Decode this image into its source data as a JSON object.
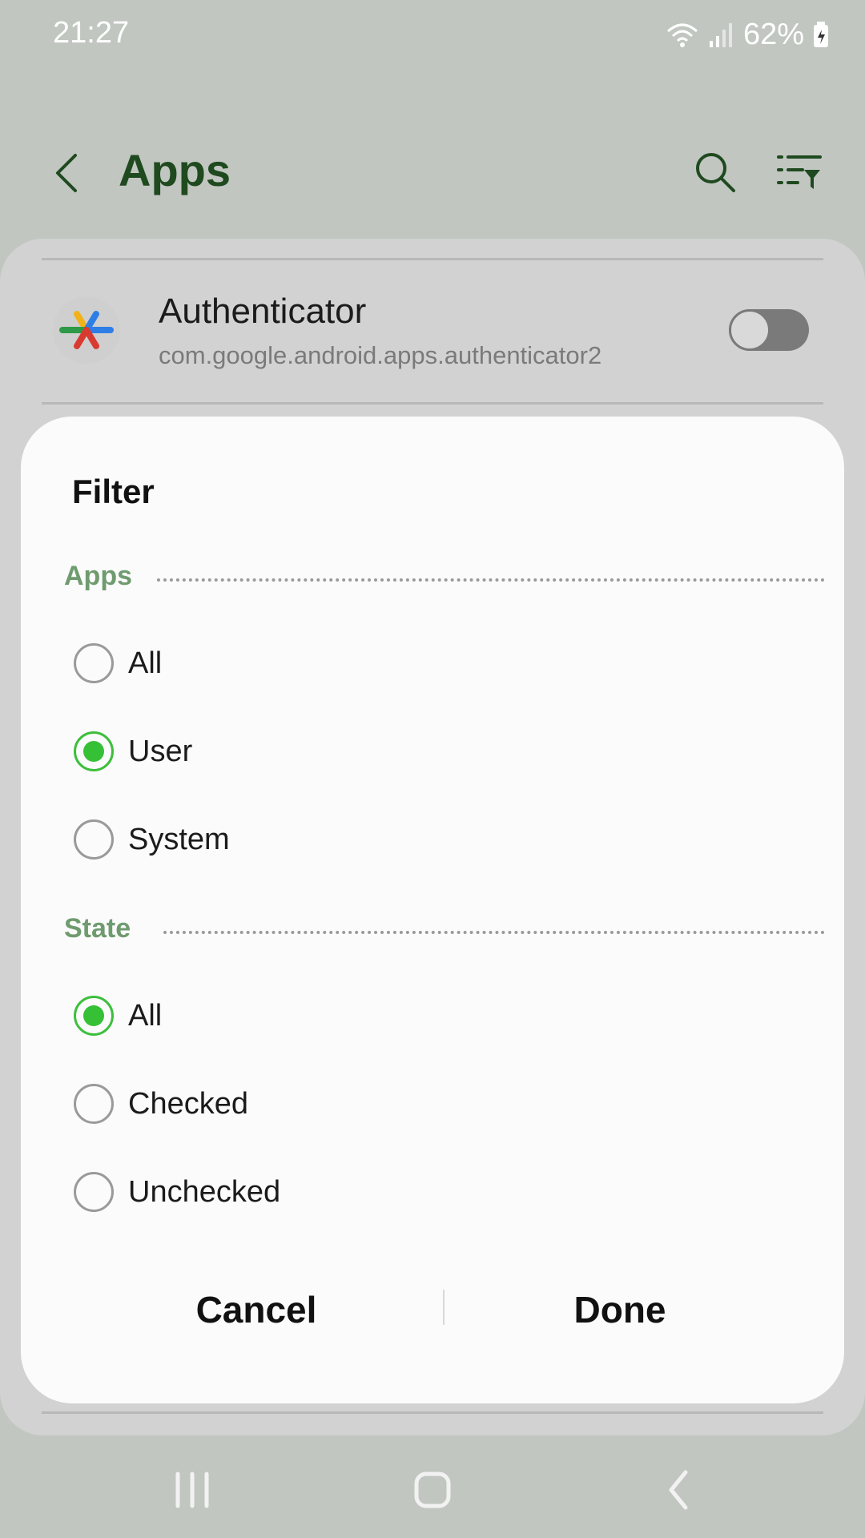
{
  "status_bar": {
    "time": "21:27",
    "battery": "62%"
  },
  "header": {
    "title": "Apps"
  },
  "app_item": {
    "name": "Authenticator",
    "package": "com.google.android.apps.authenticator2",
    "toggle_on": false
  },
  "dialog": {
    "title": "Filter",
    "sections": [
      {
        "label": "Apps",
        "options": [
          {
            "label": "All",
            "selected": false
          },
          {
            "label": "User",
            "selected": true
          },
          {
            "label": "System",
            "selected": false
          }
        ]
      },
      {
        "label": "State",
        "options": [
          {
            "label": "All",
            "selected": true
          },
          {
            "label": "Checked",
            "selected": false
          },
          {
            "label": "Unchecked",
            "selected": false
          }
        ]
      }
    ],
    "cancel_label": "Cancel",
    "done_label": "Done"
  },
  "colors": {
    "accent_green": "#36c036",
    "section_label": "#6f9b6f",
    "title_green": "#1f4a1f"
  },
  "icons": {
    "back": "chevron-left-icon",
    "search": "search-icon",
    "filter": "filter-icon",
    "nav_recents": "recents-icon",
    "nav_home": "home-icon",
    "nav_back": "back-icon"
  }
}
